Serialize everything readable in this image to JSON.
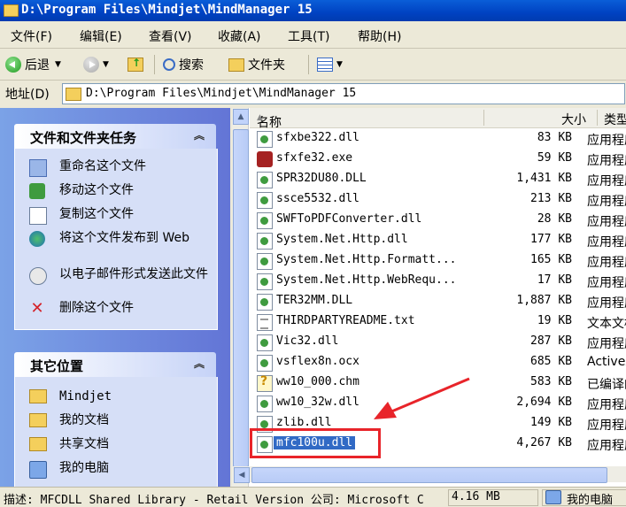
{
  "window": {
    "title": "D:\\Program Files\\Mindjet\\MindManager 15"
  },
  "menu": [
    "文件(F)",
    "编辑(E)",
    "查看(V)",
    "收藏(A)",
    "工具(T)",
    "帮助(H)"
  ],
  "toolbar": {
    "back": "后退",
    "search": "搜索",
    "folders": "文件夹"
  },
  "address": {
    "label": "地址(D)",
    "value": "D:\\Program Files\\Mindjet\\MindManager 15"
  },
  "tasks": {
    "title": "文件和文件夹任务",
    "items": [
      "重命名这个文件",
      "移动这个文件",
      "复制这个文件",
      "将这个文件发布到 Web",
      "以电子邮件形式发送此文件",
      "删除这个文件"
    ]
  },
  "places": {
    "title": "其它位置",
    "items": [
      "Mindjet",
      "我的文档",
      "共享文档",
      "我的电脑"
    ]
  },
  "columns": {
    "name": "名称",
    "size": "大小",
    "type": "类型"
  },
  "files": [
    {
      "name": "sfxbe322.dll",
      "size": "83 KB",
      "type": "应用程序扩展",
      "icon": "dll"
    },
    {
      "name": "sfxfe32.exe",
      "size": "59 KB",
      "type": "应用程序",
      "icon": "exe"
    },
    {
      "name": "SPR32DU80.DLL",
      "size": "1,431 KB",
      "type": "应用程序扩展",
      "icon": "dll"
    },
    {
      "name": "ssce5532.dll",
      "size": "213 KB",
      "type": "应用程序扩展",
      "icon": "dll"
    },
    {
      "name": "SWFToPDFConverter.dll",
      "size": "28 KB",
      "type": "应用程序扩展",
      "icon": "dll"
    },
    {
      "name": "System.Net.Http.dll",
      "size": "177 KB",
      "type": "应用程序扩展",
      "icon": "dll"
    },
    {
      "name": "System.Net.Http.Formatt...",
      "size": "165 KB",
      "type": "应用程序扩展",
      "icon": "dll"
    },
    {
      "name": "System.Net.Http.WebRequ...",
      "size": "17 KB",
      "type": "应用程序扩展",
      "icon": "dll"
    },
    {
      "name": "TER32MM.DLL",
      "size": "1,887 KB",
      "type": "应用程序扩展",
      "icon": "dll"
    },
    {
      "name": "THIRDPARTYREADME.txt",
      "size": "19 KB",
      "type": "文本文档",
      "icon": "txt"
    },
    {
      "name": "Vic32.dll",
      "size": "287 KB",
      "type": "应用程序扩展",
      "icon": "dll"
    },
    {
      "name": "vsflex8n.ocx",
      "size": "685 KB",
      "type": "ActiveX",
      "icon": "dll"
    },
    {
      "name": "ww10_000.chm",
      "size": "583 KB",
      "type": "已编译的HTML",
      "icon": "chm"
    },
    {
      "name": "ww10_32w.dll",
      "size": "2,694 KB",
      "type": "应用程序扩展",
      "icon": "dll"
    },
    {
      "name": "zlib.dll",
      "size": "149 KB",
      "type": "应用程序扩展",
      "icon": "dll"
    },
    {
      "name": "mfc100u.dll",
      "size": "4,267 KB",
      "type": "应用程序扩展",
      "icon": "dll",
      "selected": true
    }
  ],
  "status": {
    "description": "描述: MFCDLL Shared Library - Retail Version 公司: Microsoft C",
    "size": "4.16 MB",
    "location": "我的电脑"
  },
  "colors": {
    "title_bar": "#0a5ed8",
    "selection": "#316ac5",
    "annotation": "#e8242a",
    "task_pane": "#7ba2e7"
  }
}
